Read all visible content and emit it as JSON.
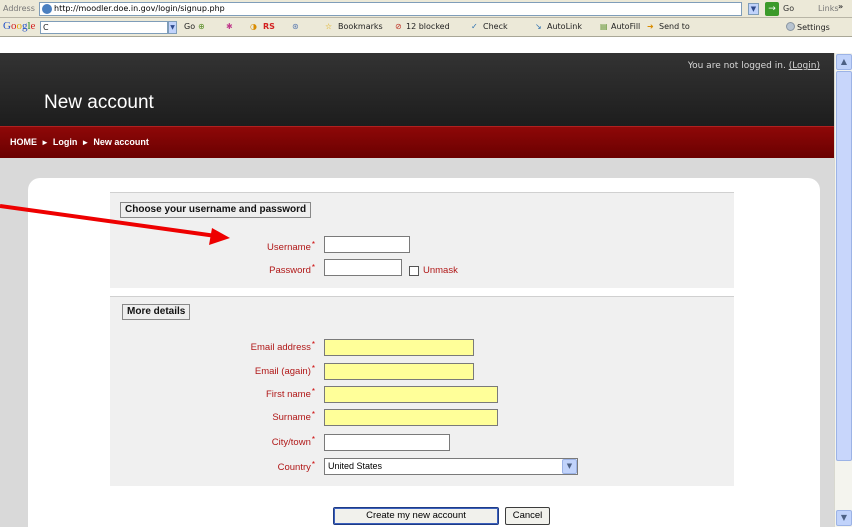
{
  "browser": {
    "address_label": "Address",
    "url": "http://moodler.doe.in.gov/login/signup.php",
    "go_label": "Go",
    "links_label": "Links",
    "links_more": "»",
    "dropdown_glyph": "▼",
    "go_glyph": "→"
  },
  "google_toolbar": {
    "logo_parts": [
      "G",
      "o",
      "o",
      "g",
      "l",
      "e"
    ],
    "search_text": "C",
    "dropdown_glyph": "▼",
    "go_label": "Go",
    "rs_label": "RS",
    "bookmarks_label": "Bookmarks",
    "blocked_label": "12 blocked",
    "check_label": "Check",
    "autolink_label": "AutoLink",
    "autofill_label": "AutoFill",
    "sendto_label": "Send to",
    "settings_label": "Settings"
  },
  "header": {
    "login_status": "You are not logged in.",
    "login_link": "(Login)",
    "site_title": "New account"
  },
  "breadcrumb": {
    "home": "HOME",
    "login": "Login",
    "current": "New account",
    "separator": "►"
  },
  "form": {
    "section1": {
      "legend": "Choose your username and password",
      "username_label": "Username",
      "password_label": "Password",
      "unmask_label": "Unmask",
      "required_mark": "*"
    },
    "section2": {
      "legend": "More details",
      "email_label": "Email address",
      "email_again_label": "Email (again)",
      "firstname_label": "First name",
      "surname_label": "Surname",
      "city_label": "City/town",
      "country_label": "Country",
      "country_value": "United States"
    },
    "submit_label": "Create my new account",
    "cancel_label": "Cancel"
  },
  "scrollbar": {
    "up_glyph": "▲",
    "down_glyph": "▼"
  },
  "colors": {
    "header_bg": "#252525",
    "navbar_bg": "#7c0000",
    "label_red": "#b01717",
    "highlight_yellow": "#ffff99",
    "annotation_arrow": "#ee0000"
  }
}
